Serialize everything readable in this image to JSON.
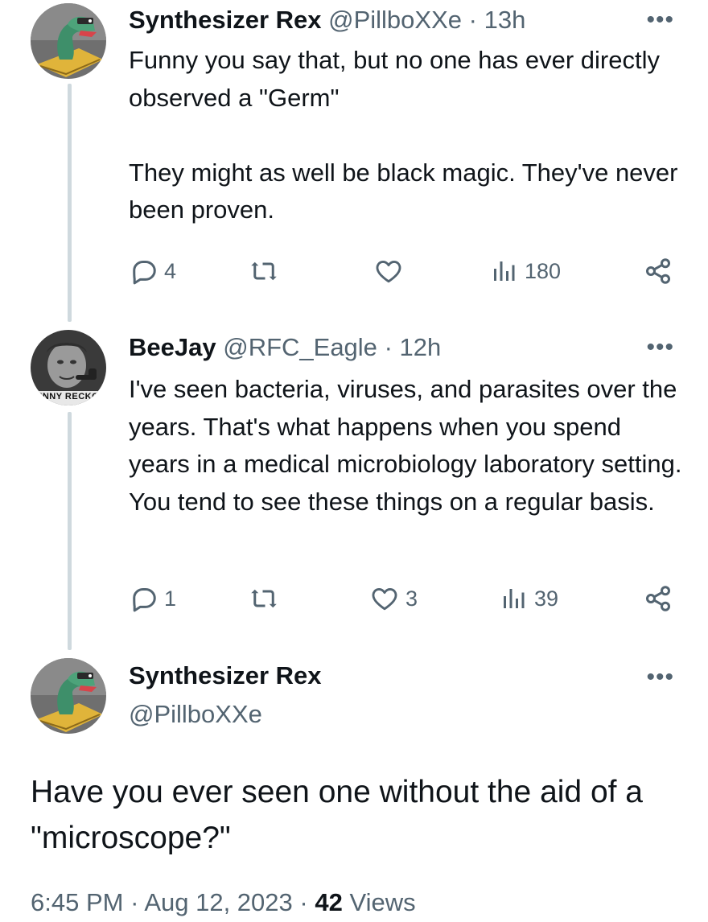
{
  "reply1": {
    "display_name": "Synthesizer Rex",
    "handle": "@PillboXXe",
    "separator": "·",
    "time": "13h",
    "text": "Funny you say that, but no one has ever directly observed a \"Germ\"\n\nThey might as well be black magic. They've never been proven.",
    "replies": "4",
    "retweets": "",
    "likes": "",
    "views": "180"
  },
  "reply2": {
    "display_name": "BeeJay",
    "handle": "@RFC_Eagle",
    "separator": "·",
    "time": "12h",
    "avatar_caption": "WINNY RECKON",
    "text": "I've seen bacteria, viruses, and parasites over the years. That's what happens when you spend years in a medical microbiology laboratory setting. You tend to see these things on a regular basis.",
    "replies": "1",
    "retweets": "",
    "likes": "3",
    "views": "39"
  },
  "main_tweet": {
    "display_name": "Synthesizer Rex",
    "handle": "@PillboXXe",
    "text": "Have you ever seen one without the aid of a \"microscope?\"",
    "time": "6:45 PM",
    "separator1": "·",
    "date": "Aug 12, 2023",
    "separator2": "·",
    "views_count": "42",
    "views_label": "Views"
  },
  "colors": {
    "text_primary": "#0f1419",
    "text_secondary": "#536471",
    "thread_line": "#cfd9de",
    "background": "#ffffff"
  },
  "icons": {
    "more": "more-dots-icon",
    "reply": "reply-icon",
    "retweet": "retweet-icon",
    "like": "heart-icon",
    "views": "views-chart-icon",
    "share": "share-icon"
  }
}
